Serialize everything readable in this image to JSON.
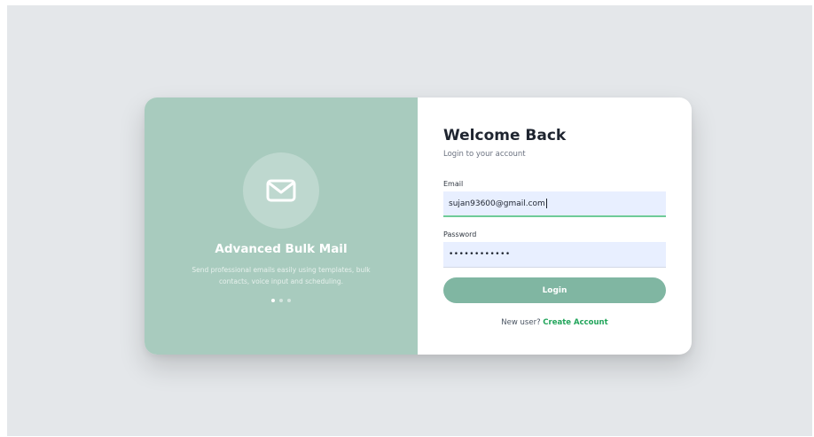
{
  "hero": {
    "icon": "mail-icon",
    "title": "Advanced Bulk Mail",
    "description": "Send professional emails easily using templates, bulk contacts, voice input and scheduling.",
    "carousel": {
      "total": 3,
      "active": 1
    }
  },
  "form": {
    "title": "Welcome Back",
    "subtitle": "Login to your account",
    "email_label": "Email",
    "email_value": "sujan93600@gmail.com",
    "password_label": "Password",
    "password_value": "••••••••••••",
    "login_label": "Login",
    "signup_prompt": "New user?",
    "signup_link": "Create Account"
  },
  "colors": {
    "panel": "#a8cbbe",
    "button": "#80b6a2",
    "link": "#22a55b",
    "input_bg": "#e8efff"
  }
}
